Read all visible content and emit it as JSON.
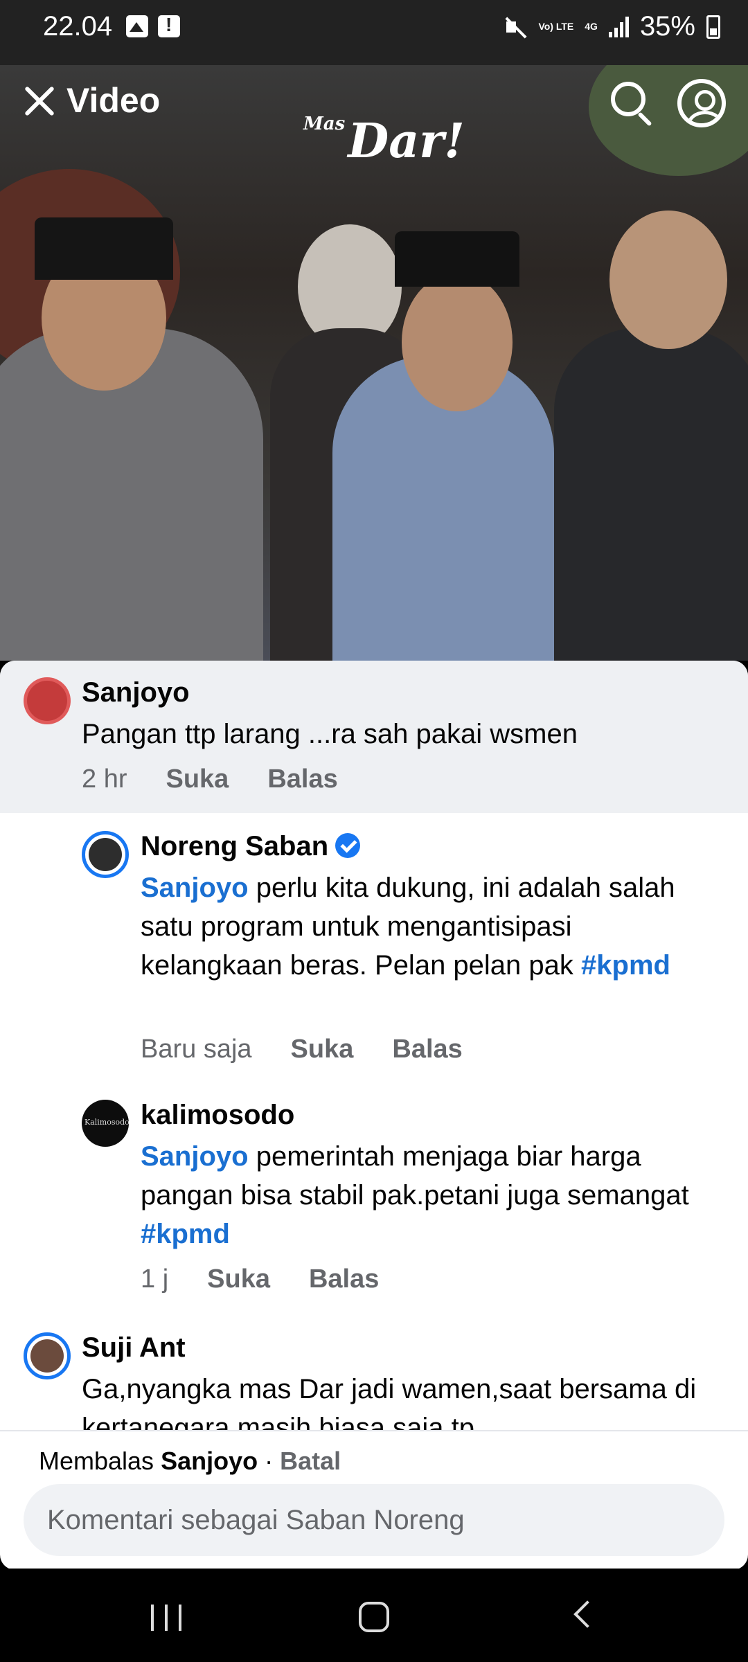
{
  "status_bar": {
    "time": "22.04",
    "left_icons": [
      "image-icon",
      "alert-icon"
    ],
    "right_icons": [
      "mute-icon",
      "volte-icon",
      "4g-icon",
      "signal-icon"
    ],
    "volte_label": "Vo) LTE",
    "network": "4G",
    "battery": "35%"
  },
  "video": {
    "title": "Video",
    "watermark_small": "Mas",
    "watermark": "Dar!",
    "icons": [
      "close-icon",
      "search-icon",
      "profile-icon"
    ]
  },
  "comments": [
    {
      "author": "Sanjoyo",
      "text": "Pangan ttp larang ...ra sah pakai wsmen",
      "time": "2 hr",
      "like_label": "Suka",
      "reply_label": "Balas",
      "highlighted": true
    },
    {
      "author": "Noreng Saban",
      "verified": true,
      "mention": "Sanjoyo",
      "text": " perlu kita dukung, ini adalah salah satu program untuk mengantisipasi kelangkaan beras. Pelan pelan pak ",
      "hashtag": "#kpmd",
      "time": "Baru saja",
      "like_label": "Suka",
      "reply_label": "Balas"
    },
    {
      "author": "kalimosodo",
      "avatar_text": "Kalimosodo",
      "mention": "Sanjoyo",
      "text": " pemerintah menjaga biar harga pangan bisa stabil  pak.petani juga semangat ",
      "hashtag": "#kpmd",
      "time": "1 j",
      "like_label": "Suka",
      "reply_label": "Balas"
    },
    {
      "author": "Suji Ant",
      "text": "Ga,nyangka mas Dar jadi wamen,saat bersama di kertanegara masih biasa saja,tp"
    }
  ],
  "reply_bar": {
    "replying_prefix": "Membalas ",
    "replying_to": "Sanjoyo",
    "separator": " · ",
    "cancel_label": "Batal",
    "placeholder": "Komentari sebagai Saban Noreng"
  },
  "nav_bar": {
    "icons": [
      "recent-apps-icon",
      "home-icon",
      "back-icon"
    ]
  },
  "colors": {
    "accent": "#1877f2",
    "mention": "#1a6fd1",
    "status_bar_bg": "#222222",
    "highlight_bg": "#eef0f3",
    "secondary_text": "#65676b"
  }
}
